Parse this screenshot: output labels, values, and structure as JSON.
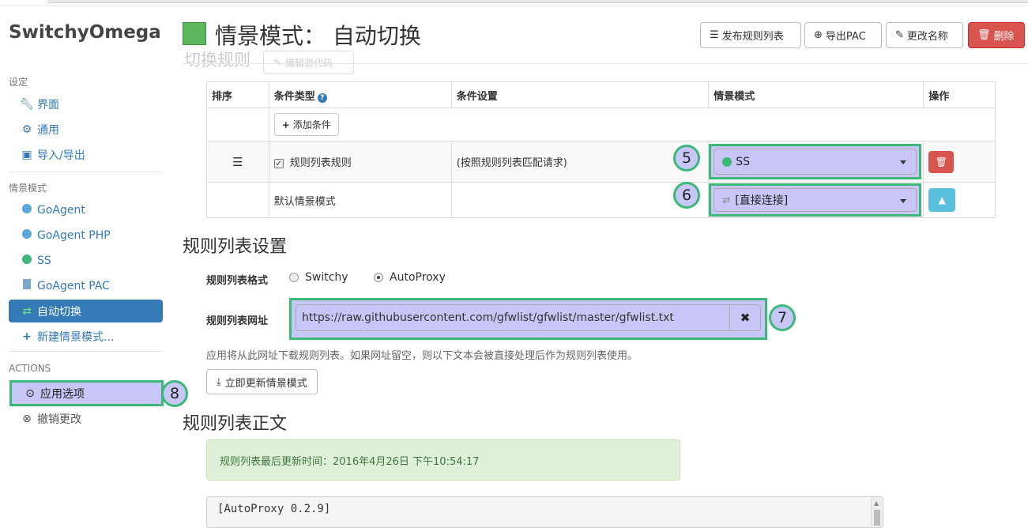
{
  "app": {
    "brand": "SwitchyOmega"
  },
  "sidebar": {
    "settings_header": "设定",
    "settings_items": [
      {
        "label": "界面",
        "icon": "wrench-icon"
      },
      {
        "label": "通用",
        "icon": "gear-icon"
      },
      {
        "label": "导入/导出",
        "icon": "floppy-icon"
      }
    ],
    "profiles_header": "情景模式",
    "profile_items": [
      {
        "label": "GoAgent",
        "icon": "globe-icon"
      },
      {
        "label": "GoAgent PHP",
        "icon": "globe-icon"
      },
      {
        "label": "SS",
        "icon": "globe-icon"
      },
      {
        "label": "GoAgent PAC",
        "icon": "file-icon"
      },
      {
        "label": "自动切换",
        "icon": "switch-icon",
        "active": true
      },
      {
        "label": "新建情景模式...",
        "icon": "plus-icon"
      }
    ],
    "actions_header": "ACTIONS",
    "actions": [
      {
        "label": "应用选项",
        "icon": "check-circle-icon"
      },
      {
        "label": "撤销更改",
        "icon": "x-circle-icon"
      }
    ]
  },
  "header": {
    "title": "情景模式： 自动切换",
    "buttons": {
      "publish": "发布规则列表",
      "export_pac": "导出PAC",
      "rename": "更改名称",
      "delete": "删除"
    },
    "ghost_section_title": "切换规则",
    "ghost_edit_source": "编辑源代码"
  },
  "rules_table": {
    "headers": [
      "排序",
      "条件类型",
      "条件设置",
      "情景模式",
      "操作"
    ],
    "add_condition": "添加条件",
    "rule_row": {
      "condition_type": "规则列表规则",
      "condition_setting": "(按照规则列表匹配请求)",
      "profile": "SS"
    },
    "default_row": {
      "label": "默认情景模式",
      "profile": "[直接连接]"
    }
  },
  "markers": {
    "m5": "5",
    "m6": "6",
    "m7": "7",
    "m8": "8"
  },
  "rule_list_settings": {
    "title": "规则列表设置",
    "format_label": "规则列表格式",
    "format_options": [
      "Switchy",
      "AutoProxy"
    ],
    "format_selected": "AutoProxy",
    "url_label": "规则列表网址",
    "url_value": "https://raw.githubusercontent.com/gfwlist/gfwlist/master/gfwlist.txt",
    "help_text": "应用将从此网址下载规则列表。如果网址留空，则以下文本会被直接处理后作为规则列表使用。",
    "update_button": "立即更新情景模式"
  },
  "rule_list_text": {
    "title": "规则列表正文",
    "last_updated": "规则列表最后更新时间：2016年4月26日 下午10:54:17",
    "content_first_line": "[AutoProxy 0.2.9]"
  },
  "colors": {
    "primary": "#337ab7",
    "danger": "#d9534f",
    "info": "#5bc0de",
    "profile_swatch": "#5cb85c",
    "highlight_fill": "#c8c6f7",
    "highlight_border": "#3cb878"
  }
}
